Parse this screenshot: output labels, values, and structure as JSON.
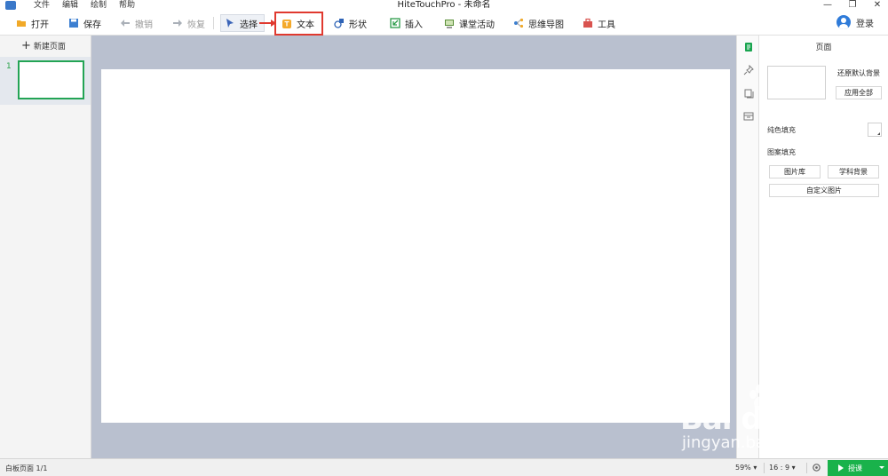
{
  "app": {
    "title": "HiteTouchPro - 未命名",
    "menu": [
      "文件",
      "编辑",
      "绘制",
      "帮助"
    ],
    "window_controls": [
      "—",
      "❐",
      "✕"
    ]
  },
  "toolbar": {
    "open": "打开",
    "save": "保存",
    "undo": "撤销",
    "redo": "恢复",
    "select": "选择",
    "text": "文本",
    "shape": "形状",
    "insert": "插入",
    "activity": "课堂活动",
    "mindmap": "思维导图",
    "tools": "工具",
    "login": "登录"
  },
  "pages": {
    "new_page": "新建页面",
    "items": [
      {
        "number": "1"
      }
    ]
  },
  "right_panel": {
    "title": "页面",
    "restore_default_bg": "还原默认背景",
    "apply_all": "应用全部",
    "solid_fill": "纯色填充",
    "pattern_fill": "图案填充",
    "image_library": "图片库",
    "subject_bg": "学科背景",
    "custom_image": "自定义图片"
  },
  "status": {
    "page_info": "白板页面 1/1",
    "zoom": "59%",
    "ratio": "16 : 9",
    "present": "授课"
  },
  "watermark": {
    "brand": "Bai du 经验",
    "url": "jingyan.baidu.com"
  },
  "colors": {
    "accent_green": "#19b24b",
    "highlight_red": "#e0392f",
    "workspace_bg": "#b9c0cf"
  }
}
